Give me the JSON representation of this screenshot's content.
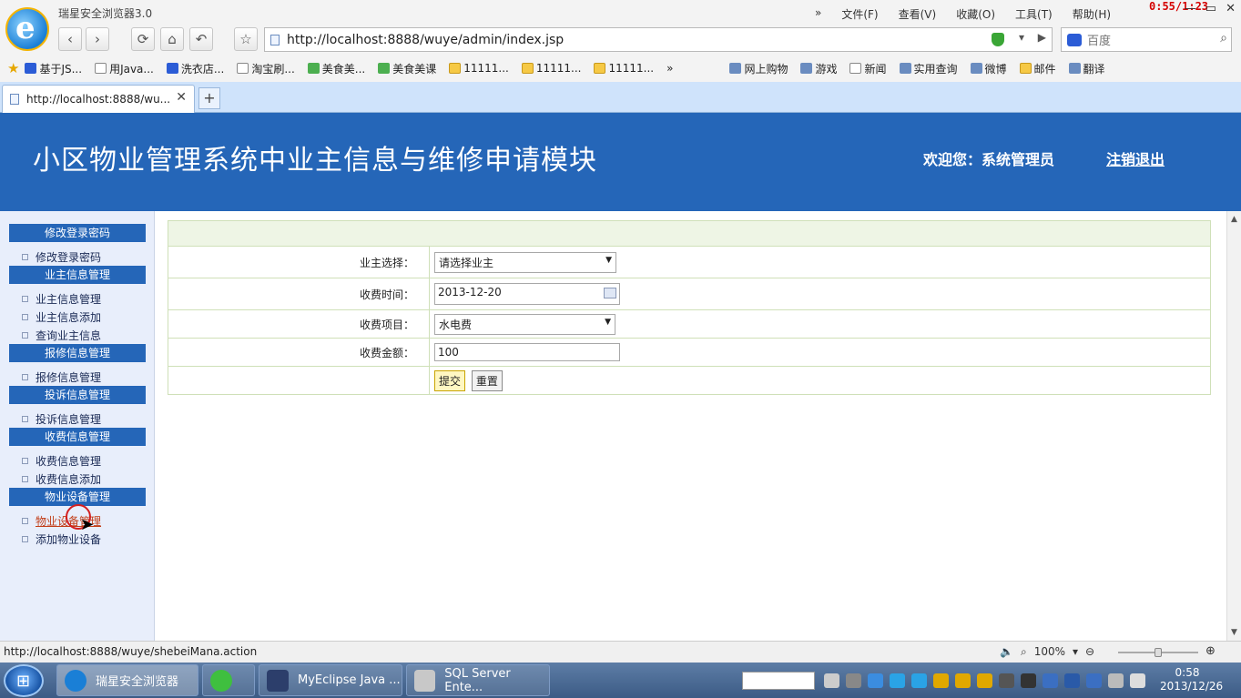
{
  "browser": {
    "title": "瑞星安全浏览器3.0",
    "menu": [
      "文件(F)",
      "查看(V)",
      "收藏(O)",
      "工具(T)",
      "帮助(H)"
    ],
    "menu_more": "»",
    "timer": "0:55/1:23",
    "url": "http://localhost:8888/wuye/admin/index.jsp",
    "search_placeholder": "百度",
    "favorites": [
      {
        "label": "基于JS...",
        "icon": "paw"
      },
      {
        "label": "用Java...",
        "icon": "doc"
      },
      {
        "label": "洗衣店...",
        "icon": "paw"
      },
      {
        "label": "淘宝刷...",
        "icon": "doc"
      },
      {
        "label": "美食美...",
        "icon": "iqy"
      },
      {
        "label": "美食美课",
        "icon": "iqy"
      },
      {
        "label": "11111...",
        "icon": "fold"
      },
      {
        "label": "11111...",
        "icon": "fold"
      },
      {
        "label": "11111...",
        "icon": "fold"
      }
    ],
    "favorites_more": "»",
    "quick_links": [
      {
        "label": "网上购物",
        "icon": "gen"
      },
      {
        "label": "游戏",
        "icon": "gen"
      },
      {
        "label": "新闻",
        "icon": "doc"
      },
      {
        "label": "实用查询",
        "icon": "gen"
      },
      {
        "label": "微博",
        "icon": "gen"
      },
      {
        "label": "邮件",
        "icon": "fold"
      },
      {
        "label": "翻译",
        "icon": "gen"
      }
    ],
    "tab_label": "http://localhost:8888/wu...",
    "tab_close": "✕",
    "new_tab": "+"
  },
  "header": {
    "title": "小区物业管理系统中业主信息与维修申请模块",
    "welcome": "欢迎您：系统管理员",
    "logout": "注销退出"
  },
  "sidebar": {
    "sections": [
      {
        "title": "修改登录密码",
        "items": [
          "修改登录密码"
        ]
      },
      {
        "title": "业主信息管理",
        "items": [
          "业主信息管理",
          "业主信息添加",
          "查询业主信息"
        ]
      },
      {
        "title": "报修信息管理",
        "items": [
          "报修信息管理"
        ]
      },
      {
        "title": "投诉信息管理",
        "items": [
          "投诉信息管理"
        ]
      },
      {
        "title": "收费信息管理",
        "items": [
          "收费信息管理",
          "收费信息添加"
        ]
      },
      {
        "title": "物业设备管理",
        "items": [
          "物业设备管理",
          "添加物业设备"
        ]
      }
    ]
  },
  "form": {
    "owner_label": "业主选择：",
    "owner_value": "请选择业主",
    "date_label": "收费时间：",
    "date_value": "2013-12-20",
    "item_label": "收费项目：",
    "item_value": "水电费",
    "amount_label": "收费金额：",
    "amount_value": "100",
    "submit": "提交",
    "reset": "重置"
  },
  "statusbar": {
    "url": "http://localhost:8888/wuye/shebeiMana.action",
    "zoom": "100%"
  },
  "taskbar": {
    "tasks": [
      "瑞星安全浏览器",
      "",
      "MyEclipse Java ...",
      "SQL Server Ente..."
    ],
    "time": "0:58",
    "date": "2013/12/26"
  }
}
